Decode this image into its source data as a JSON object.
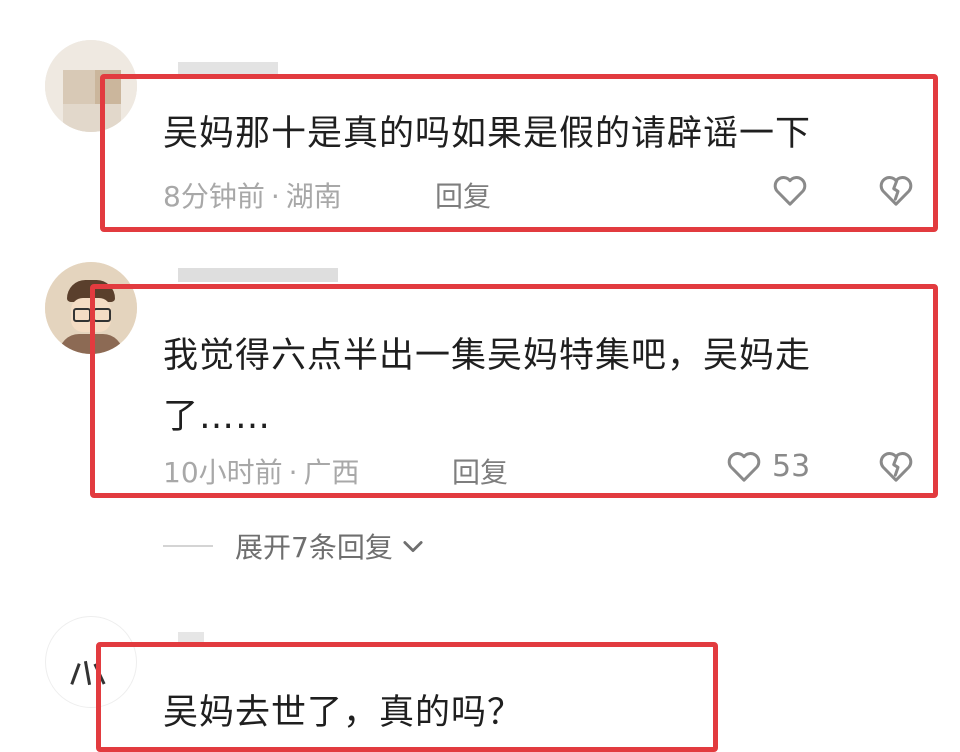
{
  "comments": [
    {
      "text": "吴妈那十是真的吗如果是假的请辟谣一下",
      "time": "8分钟前",
      "separator": "·",
      "location": "湖南",
      "reply_label": "回复",
      "like_count": ""
    },
    {
      "text_line1": "我觉得六点半出一集吴妈特集吧，吴妈走",
      "text_line2": "了……",
      "time": "10小时前",
      "separator": "·",
      "location": "广西",
      "reply_label": "回复",
      "like_count": "53",
      "expand_label": "展开7条回复"
    },
    {
      "text": "吴妈去世了，真的吗？"
    }
  ],
  "icons": {
    "like": "heart-outline-icon",
    "dislike": "broken-heart-icon",
    "expand": "chevron-down-icon"
  },
  "colors": {
    "highlight_box": "#e23b3f",
    "meta_text": "#a8a8a8",
    "reply_text": "#7e7e7e"
  }
}
